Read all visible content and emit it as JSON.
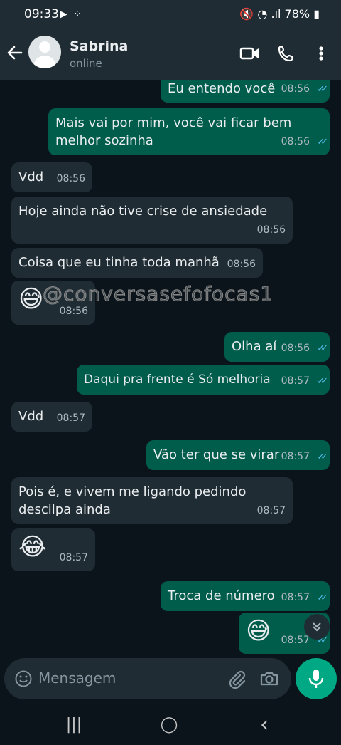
{
  "status_bar": {
    "time": "09:33",
    "left_icons": "▶ ⁘",
    "right_text": "🔇 ◔ .ıl 78% ▮",
    "battery": "78%"
  },
  "header": {
    "name": "Sabrina",
    "status": "online",
    "back_icon": "arrow-left",
    "video_icon": "video-camera",
    "call_icon": "phone",
    "menu_icon": "more-vertical"
  },
  "messages": [
    {
      "dir": "out",
      "text": "Eu entendo você",
      "time": "08:56"
    },
    {
      "dir": "out",
      "text": "Mais vai por mim, você vai ficar bem melhor sozinha",
      "time": "08:56"
    },
    {
      "dir": "in",
      "text": "Vdd",
      "time": "08:56"
    },
    {
      "dir": "in",
      "text": "Hoje ainda não tive crise de ansiedade",
      "time": "08:56"
    },
    {
      "dir": "in",
      "text": "Coisa que eu tinha toda manhã",
      "time": "08:56"
    },
    {
      "dir": "in",
      "text": "😅",
      "time": "08:56"
    },
    {
      "dir": "out",
      "text": "Olha aí",
      "time": "08:56"
    },
    {
      "dir": "out",
      "text": "Daqui pra frente é Só melhoria",
      "time": "08:57"
    },
    {
      "dir": "in",
      "text": "Vdd",
      "time": "08:57"
    },
    {
      "dir": "out",
      "text": "Vão ter que se virar",
      "time": "08:57"
    },
    {
      "dir": "in",
      "text": "Pois é, e vivem me ligando pedindo descilpa ainda",
      "time": "08:57"
    },
    {
      "dir": "in",
      "text": "😂",
      "time": "08:57"
    },
    {
      "dir": "out",
      "text": "Troca de número",
      "time": "08:57"
    },
    {
      "dir": "out",
      "text": "😅",
      "time": "08:57"
    }
  ],
  "watermark": "@conversasefofocas1",
  "input": {
    "placeholder": "Mensagem",
    "emoji_icon": "emoji-smile",
    "attach_icon": "paperclip",
    "camera_icon": "camera",
    "mic_icon": "microphone"
  },
  "scroll_down_icon": "chevron-double-down",
  "nav": {
    "recent_icon": "|||",
    "home_icon": "◯",
    "back_icon": "‹"
  },
  "colors": {
    "bg": "#0b141a",
    "bar": "#1f2c34",
    "incoming": "#202c33",
    "outgoing": "#005c4b",
    "accent": "#00a884",
    "ticks": "#53bdeb"
  }
}
